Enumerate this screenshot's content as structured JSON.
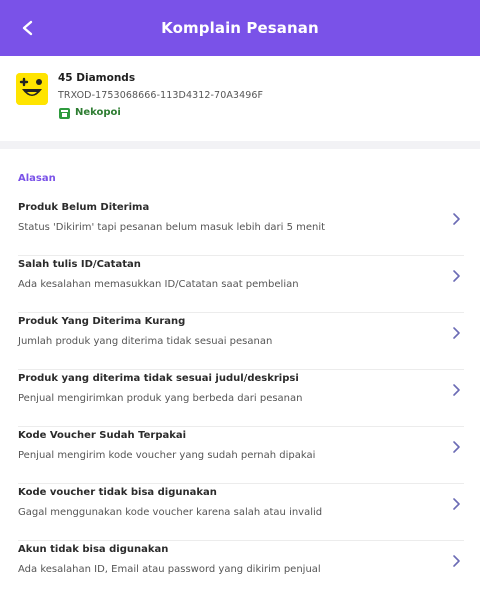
{
  "header": {
    "title": "Komplain Pesanan",
    "back_icon": "chevron-left-icon",
    "background": "#7a52e8"
  },
  "order": {
    "product_name": "45 Diamonds",
    "product_icon": "game-logo-icon",
    "transaction_id": "TRXOD-1753068666-113D4312-70A3496F",
    "seller_icon": "store-icon",
    "seller_name": "Nekopoi"
  },
  "reasons": {
    "label": "Alasan",
    "accent": "#7a52e8",
    "items": [
      {
        "title": "Produk Belum Diterima",
        "description": "Status 'Dikirim' tapi pesanan belum masuk lebih dari 5 menit"
      },
      {
        "title": "Salah tulis ID/Catatan",
        "description": "Ada kesalahan memasukkan ID/Catatan saat pembelian"
      },
      {
        "title": "Produk Yang Diterima Kurang",
        "description": "Jumlah produk yang diterima tidak sesuai pesanan"
      },
      {
        "title": "Produk yang diterima tidak sesuai judul/deskripsi",
        "description": "Penjual mengirimkan produk yang berbeda dari pesanan"
      },
      {
        "title": "Kode Voucher Sudah Terpakai",
        "description": "Penjual mengirim kode voucher yang sudah pernah dipakai"
      },
      {
        "title": "Kode voucher tidak bisa digunakan",
        "description": "Gagal menggunakan kode voucher karena salah atau invalid"
      },
      {
        "title": "Akun tidak bisa digunakan",
        "description": "Ada kesalahan ID, Email atau password yang dikirim penjual"
      }
    ]
  }
}
